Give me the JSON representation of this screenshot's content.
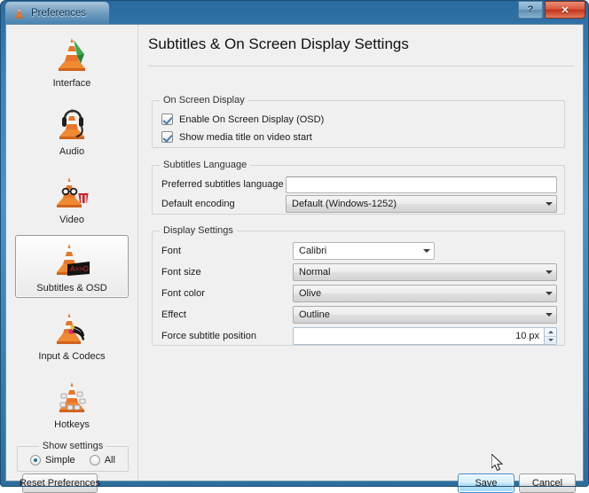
{
  "window": {
    "title": "Preferences",
    "icon": "vlc-cone-icon",
    "help_label": "?",
    "close_label": "✕",
    "accent_blue": "#3a80b5",
    "close_red": "#c3331b"
  },
  "sidebar": {
    "items": [
      {
        "label": "Interface",
        "icon": "vlc-cone-interface-icon",
        "selected": false
      },
      {
        "label": "Audio",
        "icon": "vlc-cone-audio-icon",
        "selected": false
      },
      {
        "label": "Video",
        "icon": "vlc-cone-video-icon",
        "selected": false
      },
      {
        "label": "Subtitles & OSD",
        "icon": "vlc-cone-subtitles-icon",
        "selected": true
      },
      {
        "label": "Input & Codecs",
        "icon": "vlc-cone-input-icon",
        "selected": false
      },
      {
        "label": "Hotkeys",
        "icon": "vlc-cone-hotkeys-icon",
        "selected": false
      }
    ],
    "show_settings": {
      "legend": "Show settings",
      "options": [
        {
          "label": "Simple",
          "checked": true
        },
        {
          "label": "All",
          "checked": false
        }
      ]
    }
  },
  "main": {
    "page_title": "Subtitles & On Screen Display Settings",
    "groups": {
      "osd": {
        "legend": "On Screen Display",
        "checkboxes": [
          {
            "label": "Enable On Screen Display (OSD)",
            "checked": true
          },
          {
            "label": "Show media title on video start",
            "checked": true
          }
        ]
      },
      "subtitles_language": {
        "legend": "Subtitles Language",
        "preferred_language": {
          "label": "Preferred subtitles language",
          "value": "",
          "placeholder": ""
        },
        "default_encoding": {
          "label": "Default encoding",
          "value": "Default (Windows-1252)"
        }
      },
      "display_settings": {
        "legend": "Display Settings",
        "font": {
          "label": "Font",
          "value": "Calibri"
        },
        "font_size": {
          "label": "Font size",
          "value": "Normal"
        },
        "font_color": {
          "label": "Font color",
          "value": "Olive"
        },
        "effect": {
          "label": "Effect",
          "value": "Outline"
        },
        "force_position": {
          "label": "Force subtitle position",
          "value": "10 px"
        }
      }
    }
  },
  "footer": {
    "reset_label": "Reset Preferences",
    "save_label": "Save",
    "cancel_label": "Cancel"
  }
}
